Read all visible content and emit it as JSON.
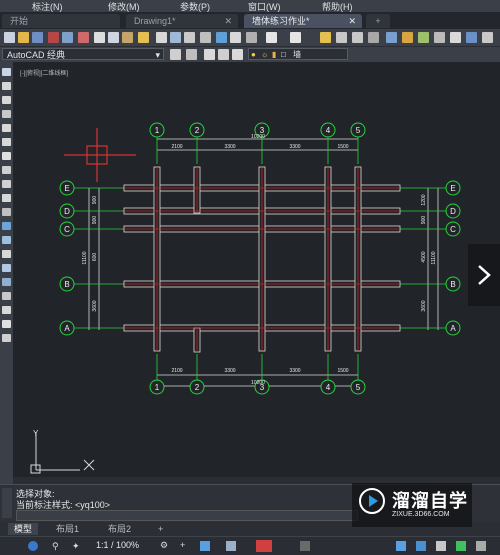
{
  "menubar": {
    "items": [
      "标注(N)",
      "修改(M)",
      "参数(P)",
      "窗口(W)",
      "帮助(H)"
    ]
  },
  "tabs": [
    {
      "label": "开始",
      "closable": false
    },
    {
      "label": "Drawing1*",
      "closable": true
    },
    {
      "label": "墙体练习作业*",
      "closable": true
    },
    {
      "label": "+",
      "closable": false
    }
  ],
  "toolbar": {
    "workspace_label": "AutoCAD 经典",
    "layer_label": "墙"
  },
  "viewport": {
    "label": "[-][俯视][二维线框]"
  },
  "drawing": {
    "grid_top": [
      "1",
      "2",
      "3",
      "4",
      "5"
    ],
    "grid_bottom": [
      "1",
      "2",
      "3",
      "4",
      "5"
    ],
    "grid_left": [
      "E",
      "D",
      "C",
      "B",
      "A"
    ],
    "grid_right": [
      "E",
      "D",
      "C",
      "B",
      "A"
    ],
    "dim_top_segments": [
      "2100",
      "3300",
      "3300",
      "1500"
    ],
    "dim_top_total": "10200",
    "dim_bottom_segments": [
      "2100",
      "3300",
      "3300",
      "1500"
    ],
    "dim_bottom_total": "10200",
    "dim_left_segments": [
      "900",
      "900",
      "600",
      "3600"
    ],
    "dim_left_total": "11100",
    "dim_right_segments": [
      "1200",
      "900",
      "4500",
      "3600"
    ],
    "dim_right_total": "11100",
    "ucs_x": "X",
    "ucs_y": "Y"
  },
  "command": {
    "line1": "选择对象:",
    "line2": "当前标注样式: <yq100>"
  },
  "layout_tabs": [
    "模型",
    "布局1",
    "布局2",
    "+"
  ],
  "status": {
    "scale": "1:1 / 100%"
  },
  "watermark": {
    "title": "溜溜自学",
    "subtitle": "ZIXUE.3D66.COM"
  },
  "colors": {
    "accent_tab": "#4a5160",
    "grid_bubble": "#27d63b",
    "wall_outline": "#d9d9d9",
    "axis_line": "#d43a3a"
  }
}
